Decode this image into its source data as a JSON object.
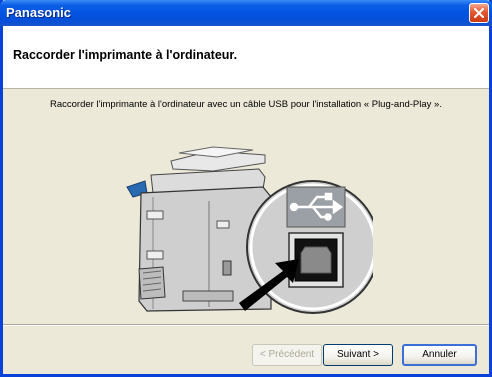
{
  "window": {
    "title": "Panasonic"
  },
  "header": {
    "title": "Raccorder l'imprimante à l'ordinateur."
  },
  "content": {
    "instruction": "Raccorder l'imprimante à l'ordinateur avec un câble USB pour l'installation « Plug-and-Play »."
  },
  "buttons": {
    "previous": "< Précédent",
    "next": "Suivant >",
    "cancel": "Annuler"
  },
  "icons": {
    "close": "close-icon",
    "usb": "usb-icon",
    "arrow": "arrow-icon"
  }
}
